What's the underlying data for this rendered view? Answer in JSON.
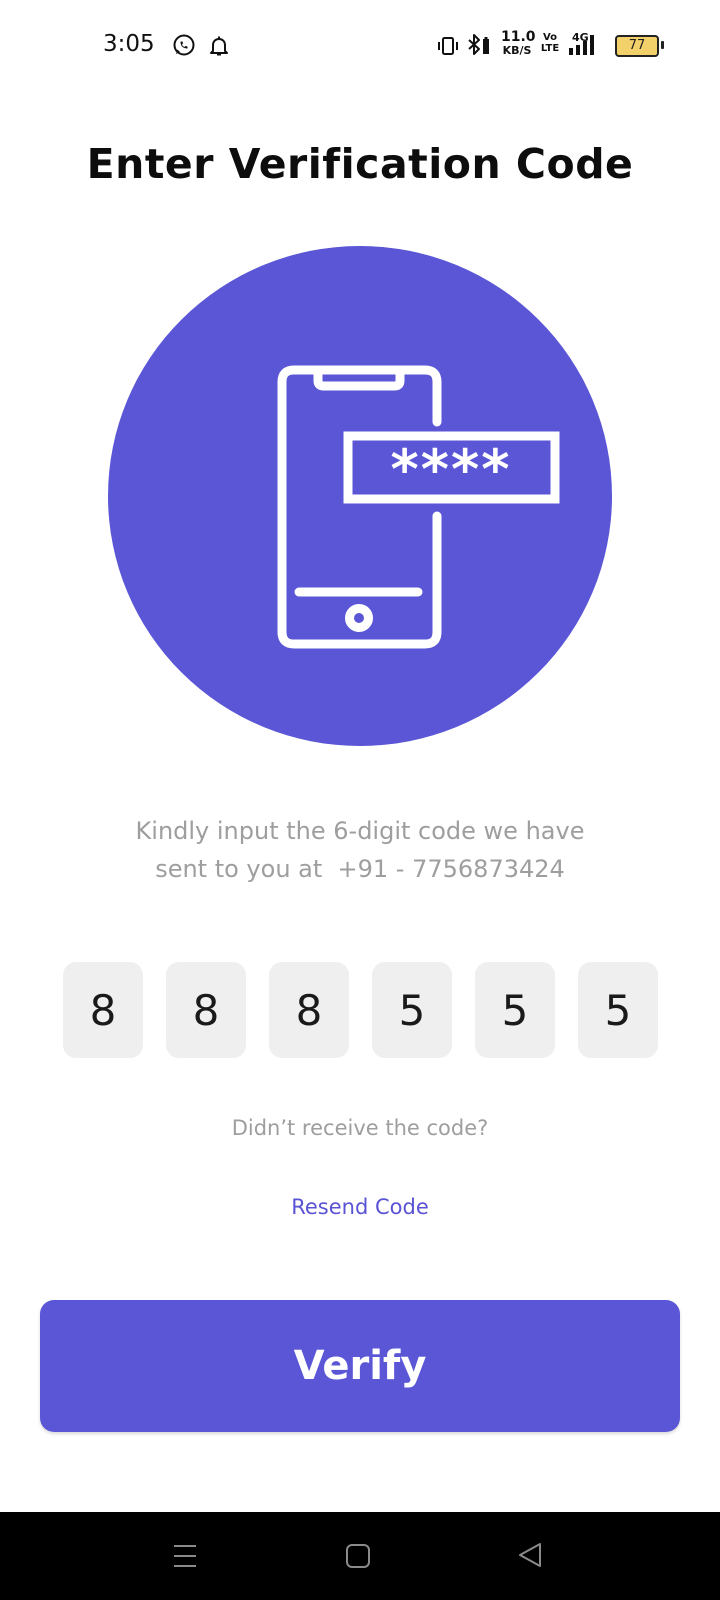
{
  "status_bar": {
    "time": "3:05",
    "network_speed_value": "11.0",
    "network_speed_unit": "KB/S",
    "volte_top": "Vo",
    "volte_bottom": "LTE",
    "network_type": "4G",
    "battery_level": "77",
    "icons": [
      "whatsapp-icon",
      "notification-bell-icon",
      "vibrate-icon",
      "bluetooth-icon",
      "signal-icon",
      "battery-icon"
    ]
  },
  "page": {
    "title": "Enter Verification Code",
    "instruction_line1": "Kindly input the 6-digit code we have",
    "instruction_line2": "sent to you at  +91 - 7756873424",
    "illustration_mask": "****"
  },
  "otp": {
    "digits": [
      "8",
      "8",
      "8",
      "5",
      "5",
      "5"
    ]
  },
  "resend": {
    "prompt": "Didn’t receive the code?",
    "link_label": "Resend Code"
  },
  "actions": {
    "verify_label": "Verify"
  },
  "colors": {
    "accent": "#5a56d6",
    "muted_text": "#9e9e9e",
    "otp_box_bg": "#efefef"
  },
  "nav_bar": {
    "icons": [
      "recent-apps-icon",
      "home-icon",
      "back-icon"
    ]
  }
}
